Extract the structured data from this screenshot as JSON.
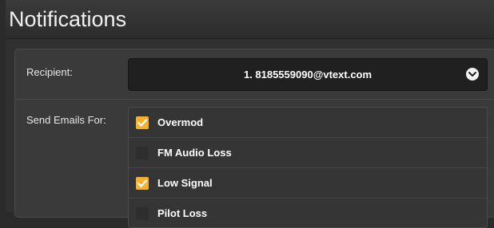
{
  "header": {
    "title": "Notifications"
  },
  "recipient": {
    "label": "Recipient:",
    "selected": "1. 8185559090@vtext.com",
    "dropdown_icon": "chevron-down-icon"
  },
  "send_emails": {
    "label": "Send Emails For:",
    "items": [
      {
        "label": "Overmod",
        "checked": true
      },
      {
        "label": "FM Audio Loss",
        "checked": false
      },
      {
        "label": "Low Signal",
        "checked": true
      },
      {
        "label": "Pilot Loss",
        "checked": false
      }
    ]
  },
  "colors": {
    "checkbox_checked": "#f5b12e",
    "panel_bg": "#3a3a3a",
    "select_bg": "#202020"
  }
}
